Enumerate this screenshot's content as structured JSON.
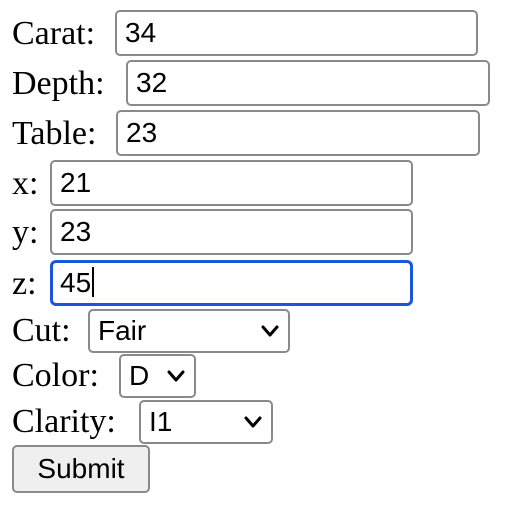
{
  "form": {
    "carat": {
      "label": "Carat:",
      "value": "34"
    },
    "depth": {
      "label": "Depth:",
      "value": "32"
    },
    "table": {
      "label": "Table:",
      "value": "23"
    },
    "x": {
      "label": "x:",
      "value": "21"
    },
    "y": {
      "label": "y:",
      "value": "23"
    },
    "z": {
      "label": "z:",
      "value": "45"
    },
    "cut": {
      "label": "Cut:",
      "selected": "Fair"
    },
    "color": {
      "label": "Color:",
      "selected": "D"
    },
    "clarity": {
      "label": "Clarity:",
      "selected": "I1"
    },
    "submit_label": "Submit"
  },
  "colors": {
    "focus_border": "#1a56db",
    "input_border": "#8a8a8a",
    "button_bg": "#efefef"
  },
  "icons": {
    "dropdown": "chevron-down-icon"
  }
}
